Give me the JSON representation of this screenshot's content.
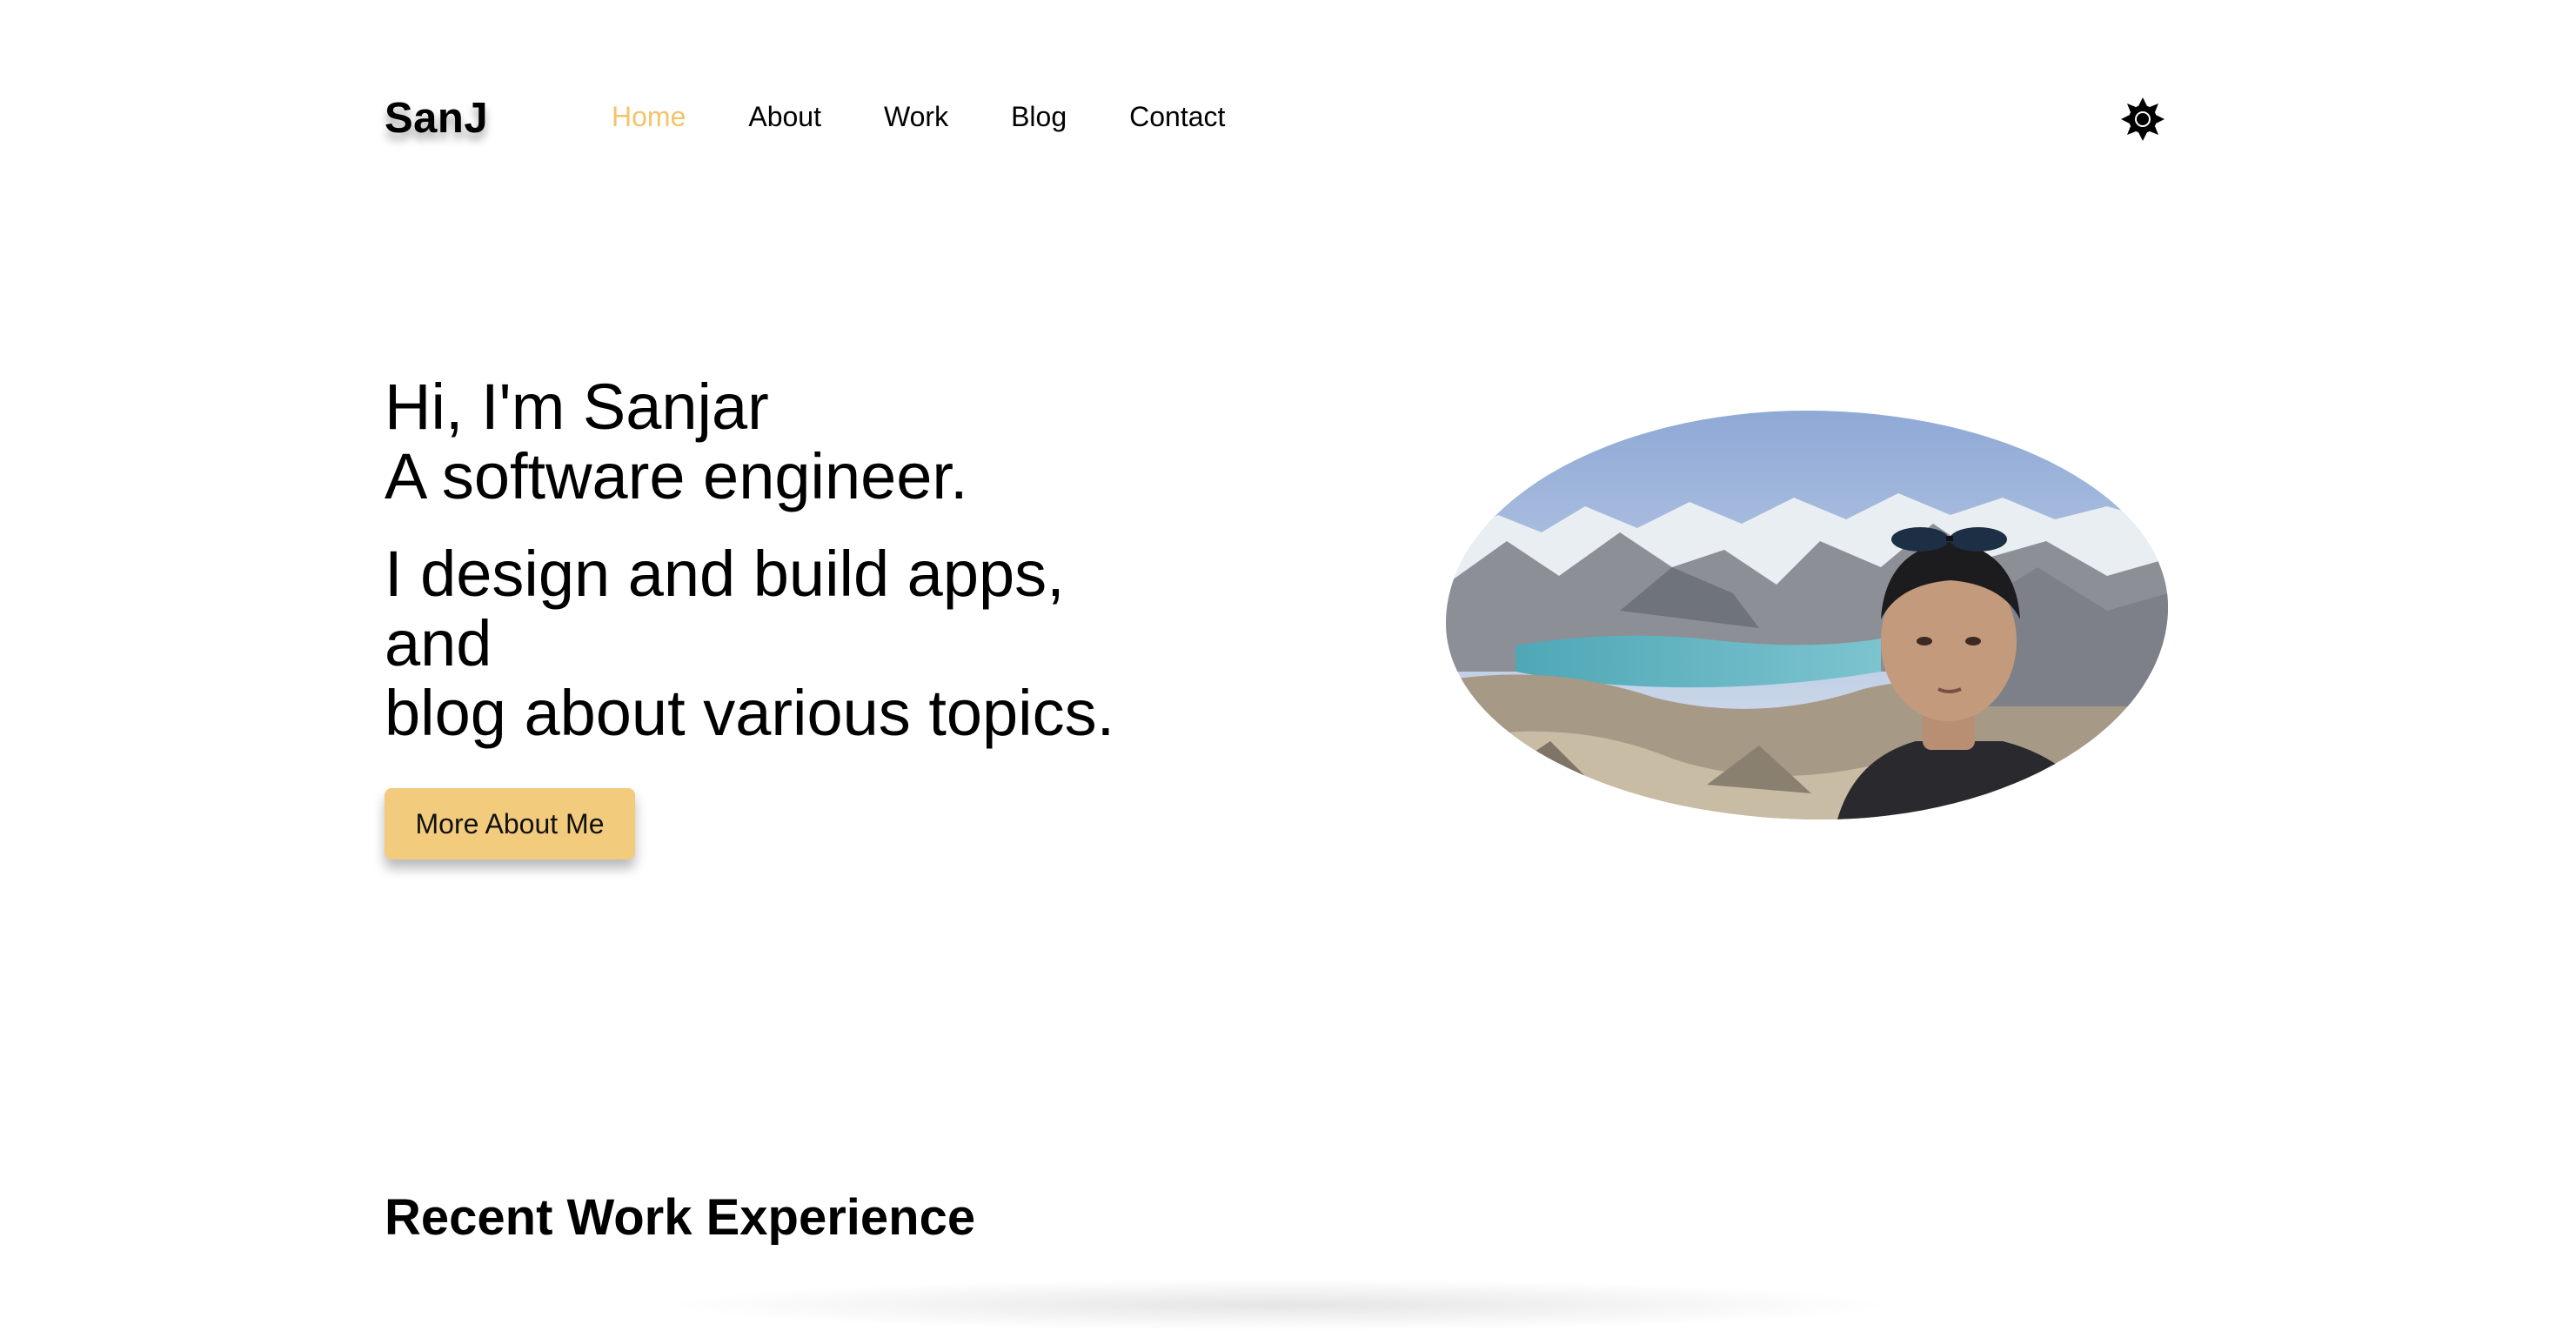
{
  "header": {
    "logo": "SanJ",
    "nav": [
      {
        "label": "Home",
        "active": true
      },
      {
        "label": "About",
        "active": false
      },
      {
        "label": "Work",
        "active": false
      },
      {
        "label": "Blog",
        "active": false
      },
      {
        "label": "Contact",
        "active": false
      }
    ],
    "theme_toggle_icon": "sun-icon"
  },
  "hero": {
    "greeting_line1": "Hi, I'm Sanjar",
    "greeting_line2": "A software engineer.",
    "subtitle_line1": "I design and build apps, and",
    "subtitle_line2": "blog about various topics.",
    "cta_label": "More About Me",
    "portrait_icon": "profile-photo"
  },
  "sections": {
    "work_title": "Recent Work Experience"
  },
  "colors": {
    "accent": "#f2c46b",
    "button_bg": "#f2cb7c",
    "text": "#000000",
    "background": "#ffffff"
  }
}
